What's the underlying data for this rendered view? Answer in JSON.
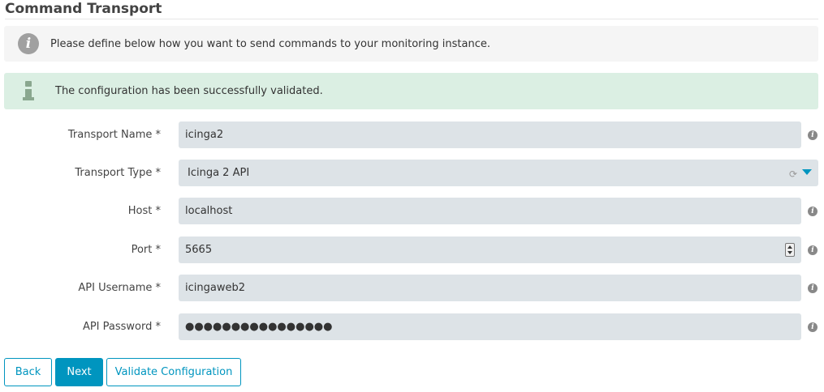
{
  "page": {
    "title": "Command Transport"
  },
  "hint": {
    "text": "Please define below how you want to send commands to your monitoring instance."
  },
  "success": {
    "text": "The configuration has been successfully validated."
  },
  "form": {
    "transport_name": {
      "label": "Transport Name *",
      "value": "icinga2"
    },
    "transport_type": {
      "label": "Transport Type *",
      "value": "Icinga 2 API"
    },
    "host": {
      "label": "Host *",
      "value": "localhost"
    },
    "port": {
      "label": "Port *",
      "value": "5665"
    },
    "api_username": {
      "label": "API Username *",
      "value": "icingaweb2"
    },
    "api_password": {
      "label": "API Password *",
      "value": "●●●●●●●●●●●●●●●●"
    }
  },
  "buttons": {
    "back": "Back",
    "next": "Next",
    "validate": "Validate Configuration"
  },
  "colors": {
    "accent": "#0095bf",
    "input_bg": "#dde3e7",
    "success_bg": "#dbefe3",
    "hint_bg": "#f5f5f5"
  }
}
